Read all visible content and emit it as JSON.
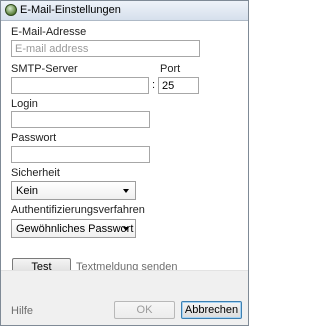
{
  "window": {
    "title": "E-Mail-Einstellungen"
  },
  "form": {
    "email_label": "E-Mail-Adresse",
    "email_placeholder": "E-mail address",
    "email_value": "",
    "smtp_label": "SMTP-Server",
    "smtp_value": "",
    "port_label": "Port",
    "port_value": "25",
    "colon": ":",
    "login_label": "Login",
    "login_value": "",
    "password_label": "Passwort",
    "password_value": "",
    "security_label": "Sicherheit",
    "security_selected": "Kein",
    "auth_label": "Authentifizierungsverfahren",
    "auth_selected": "Gewöhnliches Passwort",
    "test_button": "Test",
    "test_hint": "Textmeldung senden"
  },
  "footer": {
    "help": "Hilfe",
    "ok": "OK",
    "cancel": "Abbrechen"
  }
}
